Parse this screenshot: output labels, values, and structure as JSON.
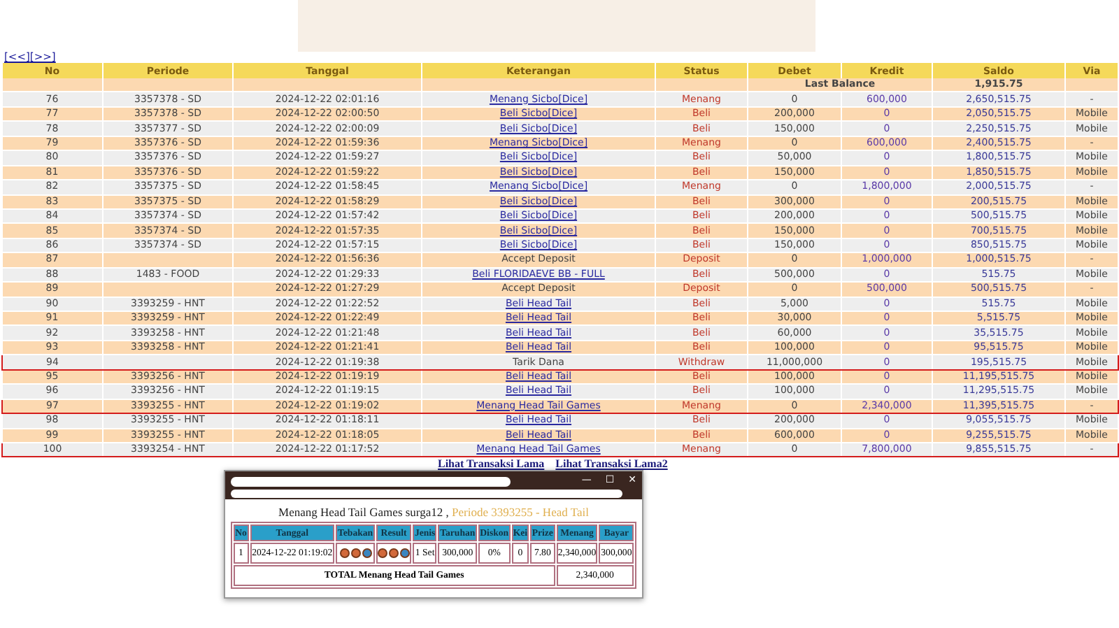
{
  "pager": [
    "[<<]",
    "[>>]"
  ],
  "table": {
    "columns": [
      "No",
      "Periode",
      "Tanggal",
      "Keterangan",
      "Status",
      "Debet",
      "Kredit",
      "Saldo",
      "Via"
    ],
    "last_balance": {
      "label": "Last Balance",
      "value": "1,915.75"
    },
    "rows": [
      {
        "no": "76",
        "periode": "3357378 - SD",
        "tanggal": "2024-12-22 02:01:16",
        "keterangan": "Menang Sicbo[Dice]",
        "kind": "link",
        "status": "Menang",
        "debet": "0",
        "kredit": "600,000",
        "saldo": "2,650,515.75",
        "via": "-",
        "flagged": false
      },
      {
        "no": "77",
        "periode": "3357378 - SD",
        "tanggal": "2024-12-22 02:00:50",
        "keterangan": "Beli Sicbo[Dice]",
        "kind": "link",
        "status": "Beli",
        "debet": "200,000",
        "kredit": "0",
        "saldo": "2,050,515.75",
        "via": "Mobile",
        "flagged": false
      },
      {
        "no": "78",
        "periode": "3357377 - SD",
        "tanggal": "2024-12-22 02:00:09",
        "keterangan": "Beli Sicbo[Dice]",
        "kind": "link",
        "status": "Beli",
        "debet": "150,000",
        "kredit": "0",
        "saldo": "2,250,515.75",
        "via": "Mobile",
        "flagged": false
      },
      {
        "no": "79",
        "periode": "3357376 - SD",
        "tanggal": "2024-12-22 01:59:36",
        "keterangan": "Menang Sicbo[Dice]",
        "kind": "link",
        "status": "Menang",
        "debet": "0",
        "kredit": "600,000",
        "saldo": "2,400,515.75",
        "via": "-",
        "flagged": false
      },
      {
        "no": "80",
        "periode": "3357376 - SD",
        "tanggal": "2024-12-22 01:59:27",
        "keterangan": "Beli Sicbo[Dice]",
        "kind": "link",
        "status": "Beli",
        "debet": "50,000",
        "kredit": "0",
        "saldo": "1,800,515.75",
        "via": "Mobile",
        "flagged": false
      },
      {
        "no": "81",
        "periode": "3357376 - SD",
        "tanggal": "2024-12-22 01:59:22",
        "keterangan": "Beli Sicbo[Dice]",
        "kind": "link",
        "status": "Beli",
        "debet": "150,000",
        "kredit": "0",
        "saldo": "1,850,515.75",
        "via": "Mobile",
        "flagged": false
      },
      {
        "no": "82",
        "periode": "3357375 - SD",
        "tanggal": "2024-12-22 01:58:45",
        "keterangan": "Menang Sicbo[Dice]",
        "kind": "link",
        "status": "Menang",
        "debet": "0",
        "kredit": "1,800,000",
        "saldo": "2,000,515.75",
        "via": "-",
        "flagged": false
      },
      {
        "no": "83",
        "periode": "3357375 - SD",
        "tanggal": "2024-12-22 01:58:29",
        "keterangan": "Beli Sicbo[Dice]",
        "kind": "link",
        "status": "Beli",
        "debet": "300,000",
        "kredit": "0",
        "saldo": "200,515.75",
        "via": "Mobile",
        "flagged": false
      },
      {
        "no": "84",
        "periode": "3357374 - SD",
        "tanggal": "2024-12-22 01:57:42",
        "keterangan": "Beli Sicbo[Dice]",
        "kind": "link",
        "status": "Beli",
        "debet": "200,000",
        "kredit": "0",
        "saldo": "500,515.75",
        "via": "Mobile",
        "flagged": false
      },
      {
        "no": "85",
        "periode": "3357374 - SD",
        "tanggal": "2024-12-22 01:57:35",
        "keterangan": "Beli Sicbo[Dice]",
        "kind": "link",
        "status": "Beli",
        "debet": "150,000",
        "kredit": "0",
        "saldo": "700,515.75",
        "via": "Mobile",
        "flagged": false
      },
      {
        "no": "86",
        "periode": "3357374 - SD",
        "tanggal": "2024-12-22 01:57:15",
        "keterangan": "Beli Sicbo[Dice]",
        "kind": "link",
        "status": "Beli",
        "debet": "150,000",
        "kredit": "0",
        "saldo": "850,515.75",
        "via": "Mobile",
        "flagged": false
      },
      {
        "no": "87",
        "tanggal": "2024-12-22 01:56:36",
        "keterangan": "Accept Deposit",
        "kind": "text",
        "status": "Deposit",
        "debet": "0",
        "kredit": "1,000,000",
        "saldo": "1,000,515.75",
        "via": "-",
        "flagged": false
      },
      {
        "no": "88",
        "periode": "1483 - FOOD",
        "tanggal": "2024-12-22 01:29:33",
        "keterangan": "Beli FLORIDAEVE BB - FULL",
        "kind": "link",
        "status": "Beli",
        "debet": "500,000",
        "kredit": "0",
        "saldo": "515.75",
        "via": "Mobile",
        "flagged": false
      },
      {
        "no": "89",
        "tanggal": "2024-12-22 01:27:29",
        "keterangan": "Accept Deposit",
        "kind": "text",
        "status": "Deposit",
        "debet": "0",
        "kredit": "500,000",
        "saldo": "500,515.75",
        "via": "-",
        "flagged": false
      },
      {
        "no": "90",
        "periode": "3393259 - HNT",
        "tanggal": "2024-12-22 01:22:52",
        "keterangan": "Beli Head Tail",
        "kind": "link",
        "status": "Beli",
        "debet": "5,000",
        "kredit": "0",
        "saldo": "515.75",
        "via": "Mobile",
        "flagged": false
      },
      {
        "no": "91",
        "periode": "3393259 - HNT",
        "tanggal": "2024-12-22 01:22:49",
        "keterangan": "Beli Head Tail",
        "kind": "link",
        "status": "Beli",
        "debet": "30,000",
        "kredit": "0",
        "saldo": "5,515.75",
        "via": "Mobile",
        "flagged": false
      },
      {
        "no": "92",
        "periode": "3393258 - HNT",
        "tanggal": "2024-12-22 01:21:48",
        "keterangan": "Beli Head Tail",
        "kind": "link",
        "status": "Beli",
        "debet": "60,000",
        "kredit": "0",
        "saldo": "35,515.75",
        "via": "Mobile",
        "flagged": false
      },
      {
        "no": "93",
        "periode": "3393258 - HNT",
        "tanggal": "2024-12-22 01:21:41",
        "keterangan": "Beli Head Tail",
        "kind": "link",
        "status": "Beli",
        "debet": "100,000",
        "kredit": "0",
        "saldo": "95,515.75",
        "via": "Mobile",
        "flagged": false
      },
      {
        "no": "94",
        "tanggal": "2024-12-22 01:19:38",
        "keterangan": "Tarik Dana",
        "kind": "text",
        "status": "Withdraw",
        "debet": "11,000,000",
        "kredit": "0",
        "saldo": "195,515.75",
        "via": "Mobile",
        "flagged": true
      },
      {
        "no": "95",
        "periode": "3393256 - HNT",
        "tanggal": "2024-12-22 01:19:19",
        "keterangan": "Beli Head Tail",
        "kind": "link",
        "status": "Beli",
        "debet": "100,000",
        "kredit": "0",
        "saldo": "11,195,515.75",
        "via": "Mobile",
        "flagged": false
      },
      {
        "no": "96",
        "periode": "3393256 - HNT",
        "tanggal": "2024-12-22 01:19:15",
        "keterangan": "Beli Head Tail",
        "kind": "link",
        "status": "Beli",
        "debet": "100,000",
        "kredit": "0",
        "saldo": "11,295,515.75",
        "via": "Mobile",
        "flagged": false
      },
      {
        "no": "97",
        "periode": "3393255 - HNT",
        "tanggal": "2024-12-22 01:19:02",
        "keterangan": "Menang Head Tail Games",
        "kind": "link",
        "status": "Menang",
        "debet": "0",
        "kredit": "2,340,000",
        "saldo": "11,395,515.75",
        "via": "-",
        "flagged": true
      },
      {
        "no": "98",
        "periode": "3393255 - HNT",
        "tanggal": "2024-12-22 01:18:11",
        "keterangan": "Beli Head Tail",
        "kind": "link",
        "status": "Beli",
        "debet": "200,000",
        "kredit": "0",
        "saldo": "9,055,515.75",
        "via": "Mobile",
        "flagged": false
      },
      {
        "no": "99",
        "periode": "3393255 - HNT",
        "tanggal": "2024-12-22 01:18:05",
        "keterangan": "Beli Head Tail",
        "kind": "link",
        "status": "Beli",
        "debet": "600,000",
        "kredit": "0",
        "saldo": "9,255,515.75",
        "via": "Mobile",
        "flagged": false
      },
      {
        "no": "100",
        "periode": "3393254 - HNT",
        "tanggal": "2024-12-22 01:17:52",
        "keterangan": "Menang Head Tail Games",
        "kind": "link",
        "status": "Menang",
        "debet": "0",
        "kredit": "7,800,000",
        "saldo": "9,855,515.75",
        "via": "-",
        "flagged": true
      }
    ]
  },
  "links": [
    "Lihat Transaksi Lama",
    "Lihat Transaksi Lama2"
  ],
  "popup": {
    "controls": [
      "—",
      "☐",
      "✕"
    ],
    "heading": "Menang Head Tail Games surga12 ,",
    "periode": "Periode 3393255 - Head Tail",
    "columns": [
      "No",
      "Tanggal",
      "Tebakan",
      "Result",
      "Jenis",
      "Taruhan",
      "Diskon",
      "Kei",
      "Prize",
      "Menang",
      "Bayar"
    ],
    "row": {
      "no": "1",
      "tanggal": "2024-12-22 01:19:02",
      "tebakan": [
        {
          "color": "#d2693a"
        },
        {
          "color": "#d2693a"
        },
        {
          "color": "#3a86c0"
        }
      ],
      "result": [
        {
          "color": "#d2693a"
        },
        {
          "color": "#d2693a"
        },
        {
          "color": "#3a86c0"
        }
      ],
      "jenis": "1 Set",
      "taruhan": "300,000",
      "diskon": "0%",
      "kei": "0",
      "prize": "7.80",
      "menang": "2,340,000",
      "bayar": "300,000"
    },
    "total_label": "TOTAL  Menang Head Tail Games",
    "total": "2,340,000"
  }
}
